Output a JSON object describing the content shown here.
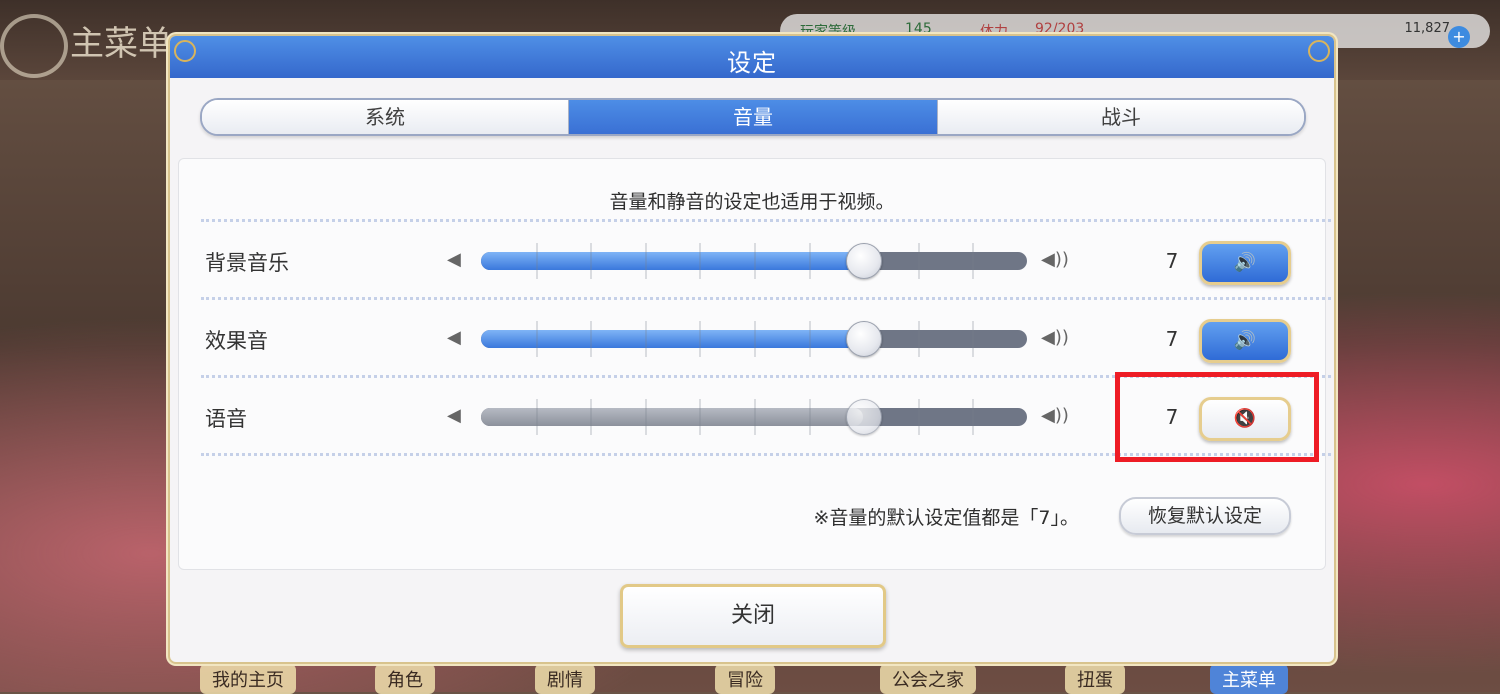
{
  "background": {
    "logo_text": "主菜单",
    "status_label": "玩家等级",
    "status_level": "145",
    "stamina_label": "体力",
    "stamina_value": "92/203",
    "gem_count": "11,827",
    "gem_add": "+",
    "nav": [
      "我的主页",
      "角色",
      "剧情",
      "冒险",
      "公会之家",
      "扭蛋",
      "主菜单"
    ]
  },
  "dialog": {
    "title": "设定",
    "tabs": [
      {
        "label": "系统",
        "active": false
      },
      {
        "label": "音量",
        "active": true
      },
      {
        "label": "战斗",
        "active": false
      }
    ],
    "notice": "音量和静音的设定也适用于视频。",
    "rows": [
      {
        "label": "背景音乐",
        "level_text": "7",
        "level": 7,
        "max": 10,
        "muted": false,
        "mute_icon": "🔊"
      },
      {
        "label": "效果音",
        "level_text": "7",
        "level": 7,
        "max": 10,
        "muted": false,
        "mute_icon": "🔊"
      },
      {
        "label": "语音",
        "level_text": "7",
        "level": 7,
        "max": 10,
        "muted": true,
        "mute_icon": "🔇"
      }
    ],
    "speaker_small_icon": "◀",
    "speaker_big_icon": "◀))",
    "footnote": "※音量的默认设定值都是「7」。",
    "reset_label": "恢复默认设定",
    "close_label": "关闭"
  },
  "colors": {
    "accent_blue": "#3a70d4",
    "highlight_red": "#ee1c25",
    "gold_border": "#e2c987"
  }
}
